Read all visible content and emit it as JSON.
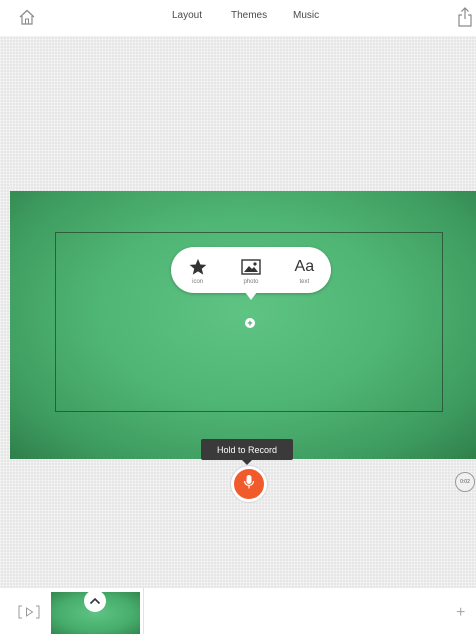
{
  "header": {
    "home_icon": "home-icon",
    "share_icon": "share-icon",
    "nav": [
      {
        "label": "Layout"
      },
      {
        "label": "Themes"
      },
      {
        "label": "Music"
      }
    ]
  },
  "canvas": {
    "slide_color": "#4fb574",
    "insert_menu": [
      {
        "label": "icon",
        "icon": "star-icon"
      },
      {
        "label": "photo",
        "icon": "photo-icon"
      },
      {
        "label": "text",
        "icon": "text-icon",
        "glyph": "Aa"
      }
    ],
    "add_button_icon": "plus-icon"
  },
  "recorder": {
    "tooltip": "Hold to Record",
    "mic_icon": "microphone-icon",
    "mic_color": "#f15a2b",
    "timer": "0:02"
  },
  "footer": {
    "preview_icon": "preview-play-icon",
    "add_slide": "+",
    "thumbnail_chevron_icon": "chevron-up-icon"
  }
}
